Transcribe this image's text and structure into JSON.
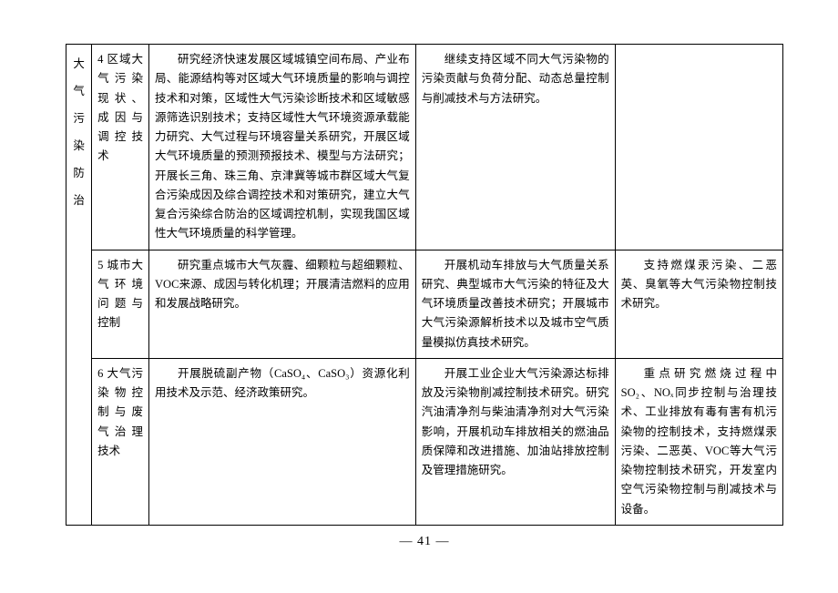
{
  "page_number": "— 41 —",
  "table": {
    "category": "大气污染防治",
    "rows": [
      {
        "topic": "4 区域大气污染现状、成因与调控技术",
        "c1": "研究经济快速发展区域城镇空间布局、产业布局、能源结构等对区域大气环境质量的影响与调控技术和对策，区域性大气污染诊断技术和区域敏感源筛选识别技术；支持区域性大气环境资源承载能力研究、大气过程与环境容量关系研究，开展区域大气环境质量的预测预报技术、模型与方法研究；开展长三角、珠三角、京津冀等城市群区域大气复合污染成因及综合调控技术和对策研究，建立大气复合污染综合防治的区域调控机制，实现我国区域性大气环境质量的科学管理。",
        "c2": "继续支持区域不同大气污染物的污染贡献与负荷分配、动态总量控制与削减技术与方法研究。",
        "c3": ""
      },
      {
        "topic": "5 城市大气环境问题与控制",
        "c1": "研究重点城市大气灰霾、细颗粒与超细颗粒、VOC来源、成因与转化机理；开展清洁燃料的应用和发展战略研究。",
        "c2": "开展机动车排放与大气质量关系研究、典型城市大气污染的特征及大气环境质量改善技术研究；开展城市大气污染源解析技术以及城市空气质量模拟仿真技术研究。",
        "c3": "支持燃煤汞污染、二恶英、臭氧等大气污染物控制技术研究。"
      },
      {
        "topic": "6 大气污染物控制与废气治理技术",
        "c1": "开展脱硫副产物（CaSO₄、CaSO₃）资源化利用技术及示范、经济政策研究。",
        "c2": "开展工业企业大气污染源达标排放及污染物削减控制技术研究。研究汽油清净剂与柴油清净剂对大气污染影响，开展机动车排放相关的燃油品质保障和改进措施、加油站排放控制及管理措施研究。",
        "c3": "重点研究燃烧过程中 SO₂、NOₓ同步控制与治理技术、工业排放有毒有害有机污染物的控制技术，支持燃煤汞污染、二恶英、VOC等大气污染物控制技术研究，开发室内空气污染物控制与削减技术与设备。"
      }
    ]
  }
}
